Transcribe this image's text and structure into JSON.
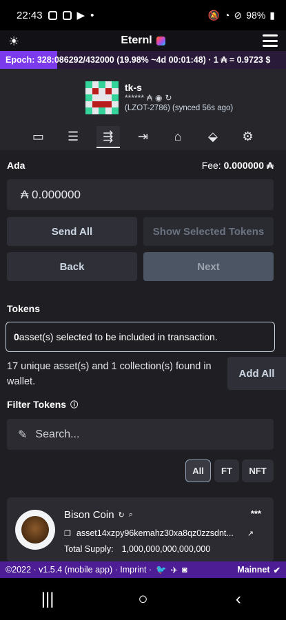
{
  "status": {
    "time": "22:43",
    "battery": "98%"
  },
  "app": {
    "title": "Eternl"
  },
  "epoch": {
    "text": "Epoch: 328:086292/432000 (19.98% ~4d 00:01:48) · 1 ₳ = 0.9723 $",
    "progress": 0.1998
  },
  "wallet": {
    "name": "tk-s",
    "masked": "******",
    "sync_text": "(LZOT-2786) (synced 56s ago)"
  },
  "tabs": [
    {
      "icon": "cash-icon"
    },
    {
      "icon": "document-icon"
    },
    {
      "icon": "send-box-icon"
    },
    {
      "icon": "receive-icon"
    },
    {
      "icon": "bank-icon"
    },
    {
      "icon": "stamp-icon"
    },
    {
      "icon": "gear-icon"
    }
  ],
  "send": {
    "ada_label": "Ada",
    "fee_label": "Fee:",
    "fee_value": "0.000000 ₳",
    "amount": "₳  0.000000",
    "send_all": "Send All",
    "show_selected": "Show Selected Tokens",
    "back": "Back",
    "next": "Next"
  },
  "tokens": {
    "label": "Tokens",
    "selected_count": "0",
    "selected_text": " asset(s) selected to be included in transaction.",
    "found_text": "17 unique asset(s) and 1 collection(s) found in wallet.",
    "add_all": "Add All",
    "filter_label": "Filter Tokens",
    "search_placeholder": "Search...",
    "filters": [
      "All",
      "FT",
      "NFT"
    ]
  },
  "token_item": {
    "name": "Bison Coin",
    "more": "***",
    "asset": "asset14xzpy96kemahz30xa8qz0zzsdnt...",
    "supply_label": "Total Supply:",
    "supply_value": "1,000,000,000,000,000"
  },
  "footer": {
    "left": "©2022 · v1.5.4 (mobile app) · Imprint ·",
    "network": "Mainnet"
  },
  "colors": {
    "accent": "#7c3aed",
    "footer": "#4c1d95"
  }
}
